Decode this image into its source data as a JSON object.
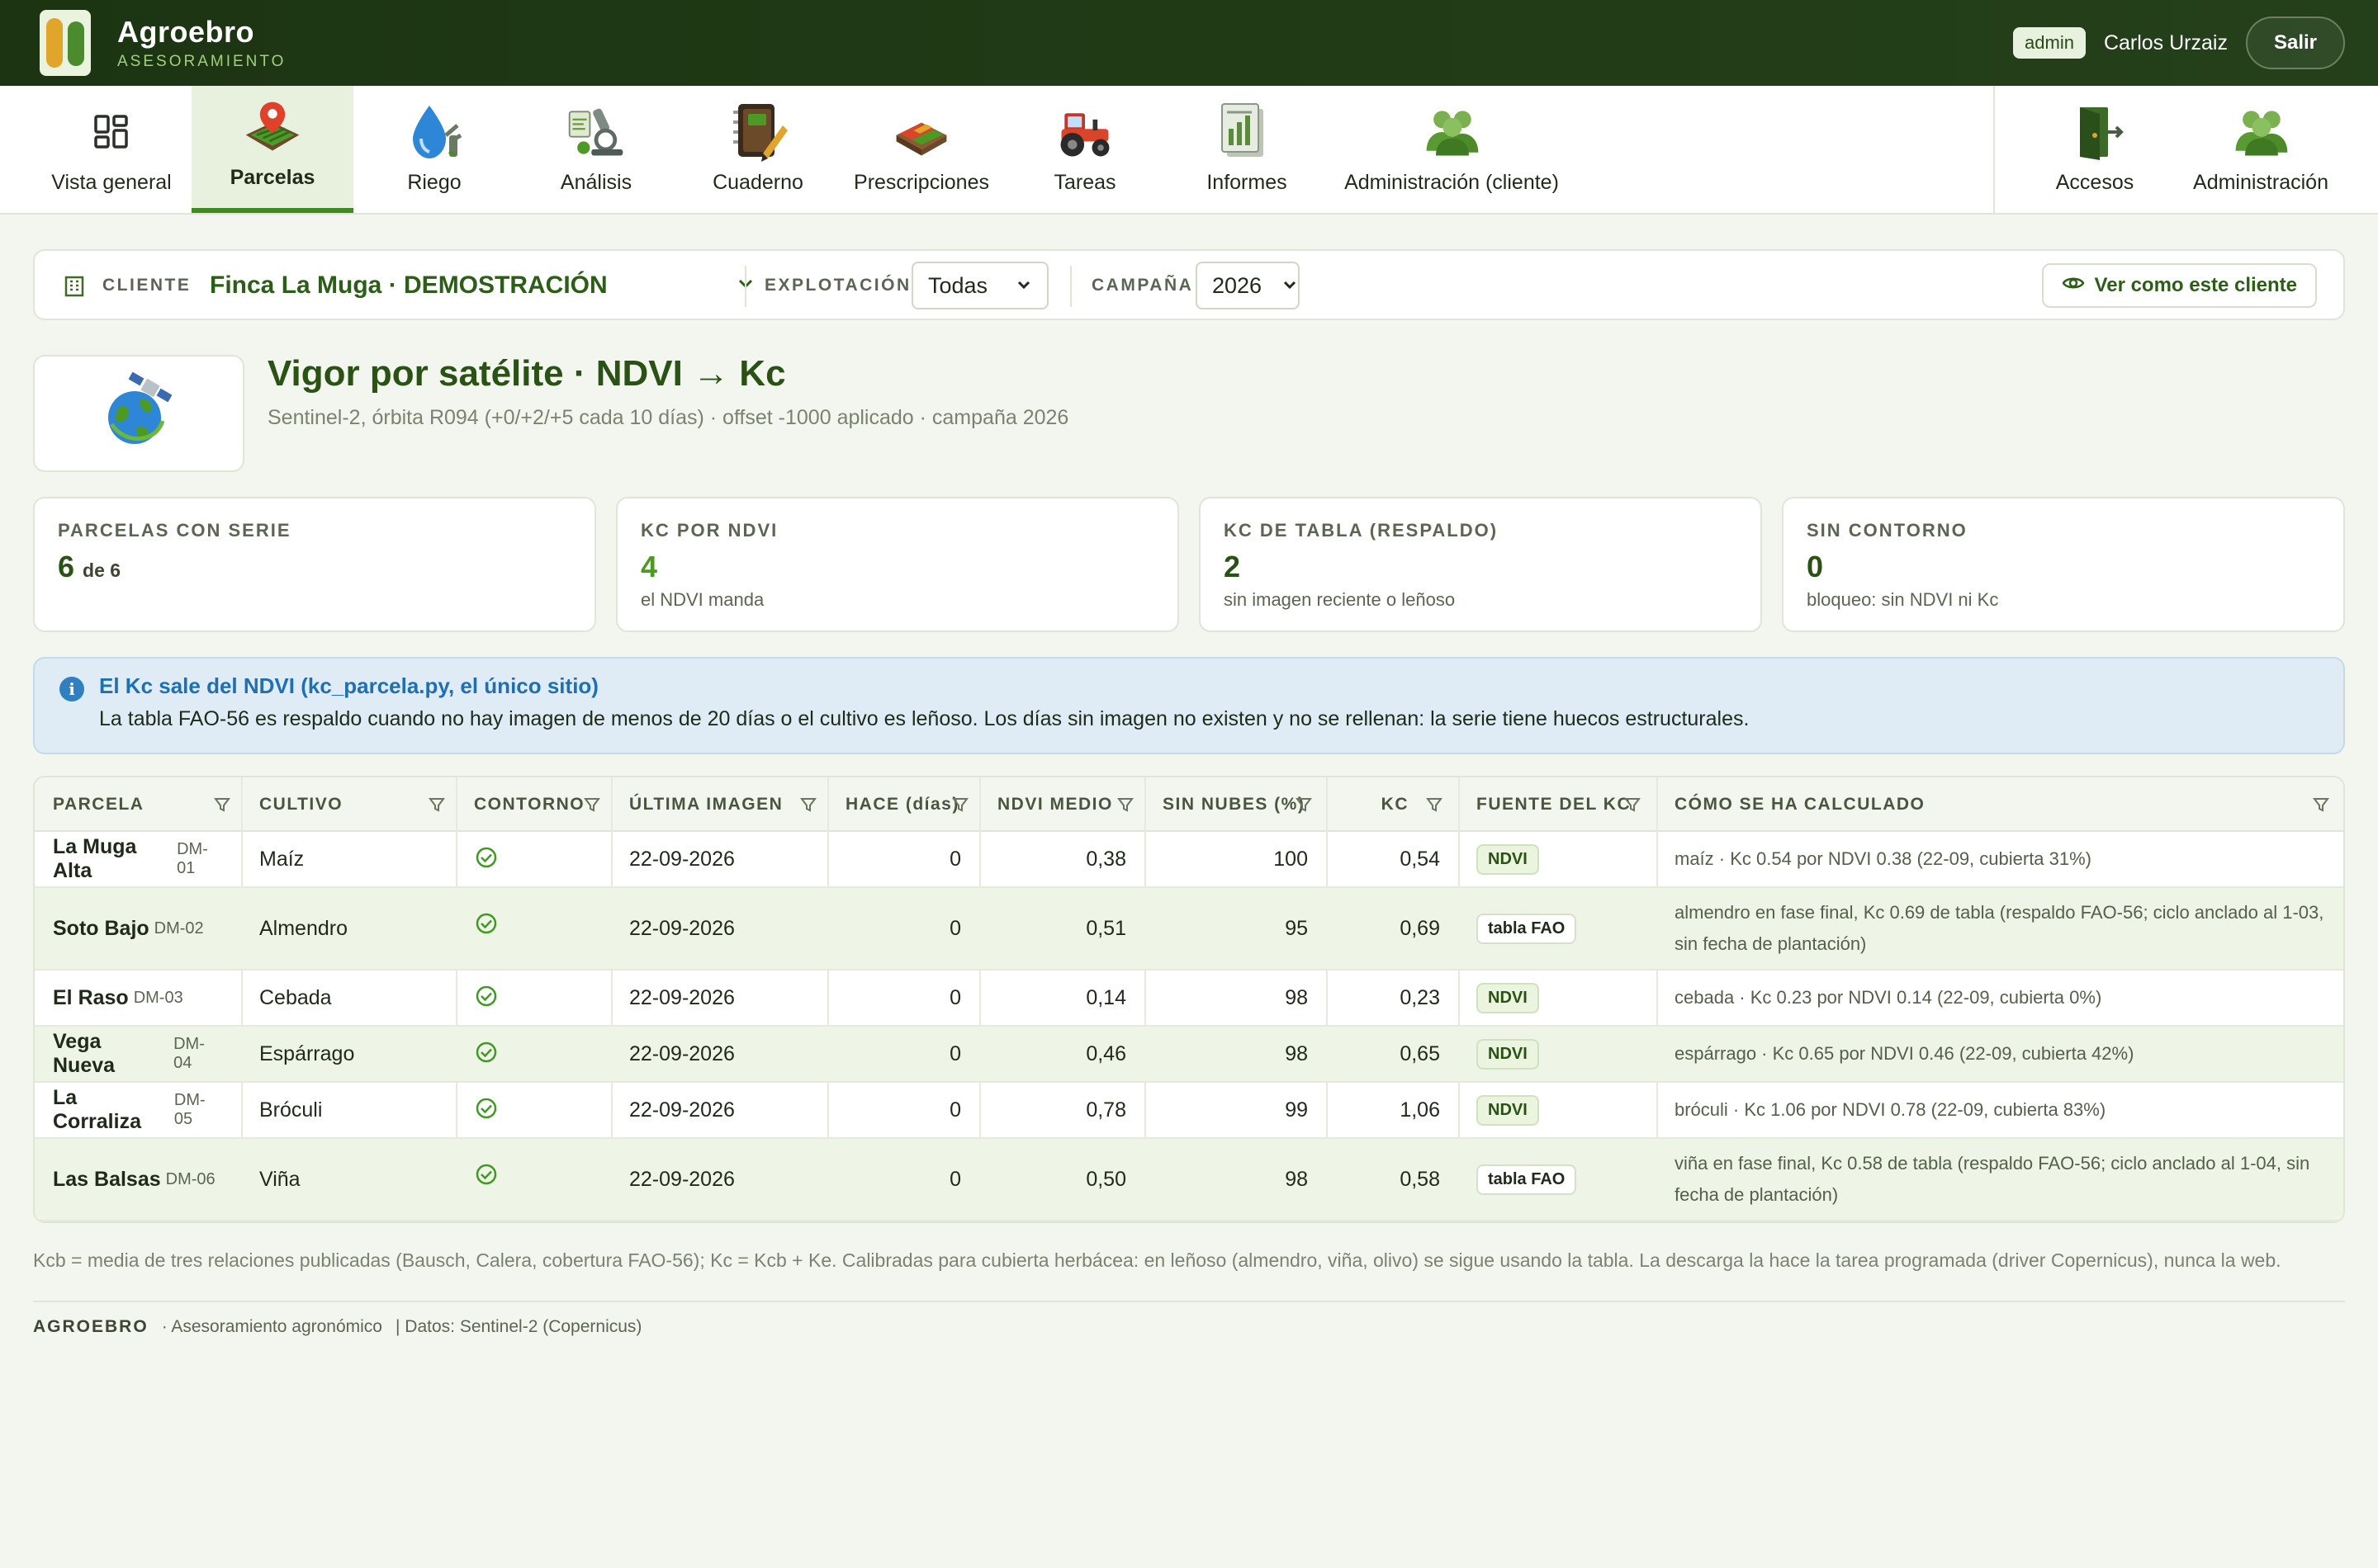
{
  "header": {
    "brand_name": "Agroebro",
    "brand_sub": "ASESORAMIENTO",
    "role_badge": "admin",
    "user_name": "Carlos Urzaiz",
    "logout_label": "Salir"
  },
  "nav": {
    "items": [
      {
        "label": "Vista general",
        "icon": "dashboard-grid-icon"
      },
      {
        "label": "Parcelas",
        "icon": "field-pin-icon",
        "active": true
      },
      {
        "label": "Riego",
        "icon": "water-drop-icon"
      },
      {
        "label": "Análisis",
        "icon": "microscope-icon"
      },
      {
        "label": "Cuaderno",
        "icon": "notebook-icon"
      },
      {
        "label": "Prescripciones",
        "icon": "prescription-map-icon"
      },
      {
        "label": "Tareas",
        "icon": "tractor-icon"
      },
      {
        "label": "Informes",
        "icon": "report-chart-icon"
      },
      {
        "label": "Administración (cliente)",
        "icon": "users-icon"
      }
    ],
    "right_items": [
      {
        "label": "Accesos",
        "icon": "door-exit-icon"
      },
      {
        "label": "Administración",
        "icon": "users-icon"
      }
    ]
  },
  "client_bar": {
    "client_label": "CLIENTE",
    "client_value": "Finca La Muga · DEMOSTRACIÓN",
    "farm_label": "EXPLOTACIÓN",
    "farm_value": "Todas",
    "season_label": "CAMPAÑA",
    "season_value": "2026",
    "view_as_label": "Ver como este cliente"
  },
  "page": {
    "title": "Vigor por satélite · NDVI → Kc",
    "subtitle": "Sentinel-2, órbita R094 (+0/+2/+5 cada 10 días) · offset -1000 aplicado · campaña 2026",
    "title_icon": "satellite-globe-icon"
  },
  "cards": [
    {
      "label": "PARCELAS CON SERIE",
      "value": "6",
      "value_suffix": "de 6",
      "note": ""
    },
    {
      "label": "KC POR NDVI",
      "value": "4",
      "value_suffix": "",
      "note": "el NDVI manda"
    },
    {
      "label": "KC DE TABLA (RESPALDO)",
      "value": "2",
      "value_suffix": "",
      "note": "sin imagen reciente o leñoso"
    },
    {
      "label": "SIN CONTORNO",
      "value": "0",
      "value_suffix": "",
      "note": "bloqueo: sin NDVI ni Kc"
    }
  ],
  "info": {
    "title": "El Kc sale del NDVI (kc_parcela.py, el único sitio)",
    "text": "La tabla FAO-56 es respaldo cuando no hay imagen de menos de 20 días o el cultivo es leñoso. Los días sin imagen no existen y no se rellenan: la serie tiene huecos estructurales."
  },
  "table": {
    "columns": [
      "PARCELA",
      "CULTIVO",
      "CONTORNO",
      "ÚLTIMA IMAGEN",
      "HACE (días)",
      "NDVI MEDIO",
      "SIN NUBES (%)",
      "KC",
      "FUENTE DEL KC",
      "CÓMO SE HA CALCULADO"
    ],
    "rows": [
      {
        "name": "La Muga Alta",
        "code": "DM-01",
        "crop": "Maíz",
        "date": "22-09-2026",
        "days": "0",
        "ndvi": "0,38",
        "clear": "100",
        "kc": "0,54",
        "source": "NDVI",
        "how": "maíz · Kc 0.54 por NDVI 0.38 (22-09, cubierta 31%)"
      },
      {
        "name": "Soto Bajo",
        "code": "DM-02",
        "crop": "Almendro",
        "date": "22-09-2026",
        "days": "0",
        "ndvi": "0,51",
        "clear": "95",
        "kc": "0,69",
        "source": "tabla FAO",
        "how": "almendro en fase final, Kc 0.69 de tabla (respaldo FAO-56; ciclo anclado al 1-03, sin fecha de plantación)"
      },
      {
        "name": "El Raso",
        "code": "DM-03",
        "crop": "Cebada",
        "date": "22-09-2026",
        "days": "0",
        "ndvi": "0,14",
        "clear": "98",
        "kc": "0,23",
        "source": "NDVI",
        "how": "cebada · Kc 0.23 por NDVI 0.14 (22-09, cubierta 0%)"
      },
      {
        "name": "Vega Nueva",
        "code": "DM-04",
        "crop": "Espárrago",
        "date": "22-09-2026",
        "days": "0",
        "ndvi": "0,46",
        "clear": "98",
        "kc": "0,65",
        "source": "NDVI",
        "how": "espárrago · Kc 0.65 por NDVI 0.46 (22-09, cubierta 42%)"
      },
      {
        "name": "La Corraliza",
        "code": "DM-05",
        "crop": "Bróculi",
        "date": "22-09-2026",
        "days": "0",
        "ndvi": "0,78",
        "clear": "99",
        "kc": "1,06",
        "source": "NDVI",
        "how": "bróculi · Kc 1.06 por NDVI 0.78 (22-09, cubierta 83%)"
      },
      {
        "name": "Las Balsas",
        "code": "DM-06",
        "crop": "Viña",
        "date": "22-09-2026",
        "days": "0",
        "ndvi": "0,50",
        "clear": "98",
        "kc": "0,58",
        "source": "tabla FAO",
        "how": "viña en fase final, Kc 0.58 de tabla (respaldo FAO-56; ciclo anclado al 1-04, sin fecha de plantación)"
      }
    ]
  },
  "footnote": "Kcb = media de tres relaciones publicadas (Bausch, Calera, cobertura FAO-56); Kc = Kcb + Ke. Calibradas para cubierta herbácea: en leñoso (almendro, viña, olivo) se sigue usando la tabla. La descarga la hace la tarea programada (driver Copernicus), nunca la web.",
  "footer": {
    "brand": "AGROEBRO",
    "tagline": "· Asesoramiento agronómico",
    "data_source": "| Datos: Sentinel-2 (Copernicus)"
  },
  "colors": {
    "header_bg": "#1c3412",
    "accent_green": "#3f8a22",
    "title_green": "#2b5215",
    "info_blue": "#1f6fb3",
    "page_bg": "#f3f6ef"
  }
}
